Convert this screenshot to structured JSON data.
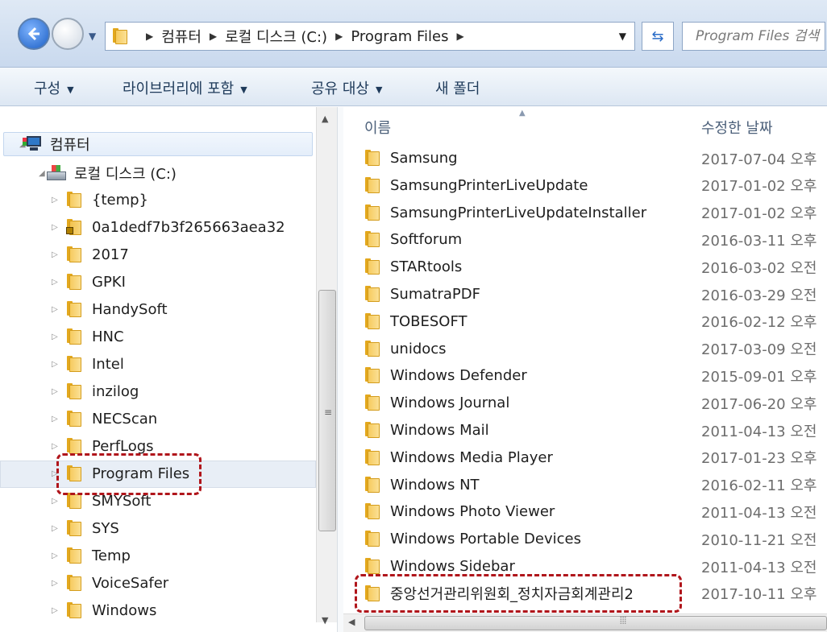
{
  "address_bar": {
    "breadcrumbs": [
      "컴퓨터",
      "로컬 디스크 (C:)",
      "Program Files"
    ],
    "search_placeholder": "Program Files 검색"
  },
  "command_bar": [
    {
      "label": "구성",
      "has_dropdown": true
    },
    {
      "label": "라이브러리에 포함",
      "has_dropdown": true
    },
    {
      "label": "공유 대상",
      "has_dropdown": true
    },
    {
      "label": "새 폴더",
      "has_dropdown": false
    }
  ],
  "nav_tree": {
    "computer_label": "컴퓨터",
    "drive_label": "로컬 디스크 (C:)",
    "folders": [
      {
        "label": "{temp}",
        "locked": false
      },
      {
        "label": "0a1dedf7b3f265663aea32",
        "locked": true
      },
      {
        "label": "2017",
        "locked": false
      },
      {
        "label": "GPKI",
        "locked": false
      },
      {
        "label": "HandySoft",
        "locked": false
      },
      {
        "label": "HNC",
        "locked": false
      },
      {
        "label": "Intel",
        "locked": false
      },
      {
        "label": "inzilog",
        "locked": false
      },
      {
        "label": "NECScan",
        "locked": false
      },
      {
        "label": "PerfLogs",
        "locked": false
      },
      {
        "label": "Program Files",
        "locked": false,
        "highlighted": true
      },
      {
        "label": "SMYSoft",
        "locked": false
      },
      {
        "label": "SYS",
        "locked": false
      },
      {
        "label": "Temp",
        "locked": false
      },
      {
        "label": "VoiceSafer",
        "locked": false
      },
      {
        "label": "Windows",
        "locked": false
      }
    ]
  },
  "file_list": {
    "columns": {
      "name": "이름",
      "date": "수정한 날짜"
    },
    "rows": [
      {
        "name": "Samsung",
        "date": "2017-07-04 오후"
      },
      {
        "name": "SamsungPrinterLiveUpdate",
        "date": "2017-01-02 오후"
      },
      {
        "name": "SamsungPrinterLiveUpdateInstaller",
        "date": "2017-01-02 오후"
      },
      {
        "name": "Softforum",
        "date": "2016-03-11 오후"
      },
      {
        "name": "STARtools",
        "date": "2016-03-02 오전"
      },
      {
        "name": "SumatraPDF",
        "date": "2016-03-29 오전"
      },
      {
        "name": "TOBESOFT",
        "date": "2016-02-12 오후"
      },
      {
        "name": "unidocs",
        "date": "2017-03-09 오전"
      },
      {
        "name": "Windows Defender",
        "date": "2015-09-01 오후"
      },
      {
        "name": "Windows Journal",
        "date": "2017-06-20 오후"
      },
      {
        "name": "Windows Mail",
        "date": "2011-04-13 오전"
      },
      {
        "name": "Windows Media Player",
        "date": "2017-01-23 오후"
      },
      {
        "name": "Windows NT",
        "date": "2016-02-11 오후"
      },
      {
        "name": "Windows Photo Viewer",
        "date": "2011-04-13 오전"
      },
      {
        "name": "Windows Portable Devices",
        "date": "2010-11-21 오전"
      },
      {
        "name": "Windows Sidebar",
        "date": "2011-04-13 오전"
      },
      {
        "name": "중앙선거관리위원회_정치자금회계관리2",
        "date": "2017-10-11 오후",
        "highlighted": true
      }
    ]
  },
  "colors": {
    "highlight_border": "#b0151b",
    "folder_yellow": "#f6c95a",
    "command_text": "#1e3a5a"
  }
}
